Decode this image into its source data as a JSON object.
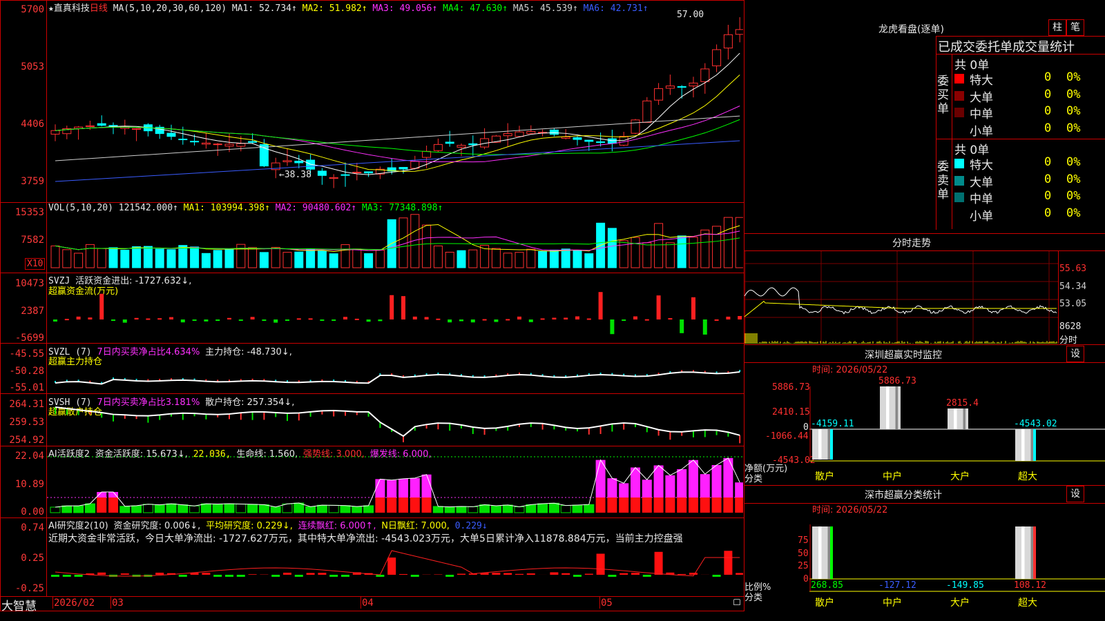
{
  "stock": {
    "star": "★",
    "name": "直真科技",
    "period": "日线",
    "ma_header": "MA(5,10,20,30,60,120)",
    "ma1": "MA1: 52.734↑",
    "ma2": "MA2: 51.982↑",
    "ma3": "MA3: 49.056↑",
    "ma4": "MA4: 47.630↑",
    "ma5": "MA5: 45.539↑",
    "ma6": "MA6: 42.731↑",
    "high_marker": "57.00",
    "low_marker": "←38.38"
  },
  "price_axis": [
    "5700",
    "5053",
    "4406",
    "3759"
  ],
  "vol": {
    "header": "VOL(5,10,20)",
    "value": "121542.000↑",
    "ma1": "MA1: 103994.398↑",
    "ma2": "MA2: 90480.602↑",
    "ma3": "MA3: 77348.898↑",
    "axis": [
      "15353",
      "7582"
    ],
    "multiplier": "X10"
  },
  "svzj": {
    "header": "SVZJ",
    "line1": "活跃资金进出: -1727.632↓,",
    "line2": "超赢资金流(万元)",
    "axis": [
      "10473",
      "2387",
      "-5699"
    ]
  },
  "svzl": {
    "header": "SVZL (7)",
    "pct": "7日内买卖净占比4.634%",
    "main": "主力持仓: -48.730↓,",
    "line2": "超赢主力持仓",
    "axis": [
      "-45.55",
      "-50.28",
      "-55.01"
    ]
  },
  "svsh": {
    "header": "SVSH (7)",
    "pct": "7日内买卖净占比3.181%",
    "retail": "散户持仓: 257.354↓,",
    "line2": "超赢散户持仓",
    "axis": [
      "264.31",
      "259.53",
      "254.92"
    ]
  },
  "ai2": {
    "header": "AI活跃度2",
    "act": "资金活跃度: 15.673↓,",
    "v2": "22.036,",
    "life": "生命线: 1.560,",
    "strong": "强势线: 3.000,",
    "burst": "爆发线: 6.000,",
    "axis": [
      "22.04",
      "10.89",
      "0.00"
    ]
  },
  "airesearch": {
    "header": "AI研究度2(10)",
    "research": "资金研究度: 0.006↓,",
    "avg": "平均研究度: 0.229↓,",
    "cont": "连续飘红: 6.000↑,",
    "nday": "N日飘红: 7.000,",
    "last": "0.229↓",
    "summary": "近期大资金非常活跃，今日大单净流出: -1727.627万元，其中特大单净流出: -4543.023万元，大单5日累计净入11878.884万元，当前主力控盘强",
    "axis": [
      "0.74",
      "0.25",
      "-0.25"
    ]
  },
  "bottom": {
    "brand": "大智慧",
    "dates": [
      "2026/02",
      "03",
      "04",
      "05"
    ]
  },
  "longhu": {
    "title": "龙虎看盘(逐单)",
    "btn1": "柱",
    "btn2": "笔",
    "header": "已成交委托单成交量统计",
    "buy_label": "委买单",
    "sell_label": "委卖单",
    "buy_total": "共 0单",
    "sell_total": "共 0单",
    "buy_rows": [
      {
        "label": "特大",
        "count": "0",
        "pct": "0%",
        "color": "#ff0000"
      },
      {
        "label": "大单",
        "count": "0",
        "pct": "0%",
        "color": "#8b0000"
      },
      {
        "label": "中单",
        "count": "0",
        "pct": "0%",
        "color": "#6a0000"
      },
      {
        "label": "小单",
        "count": "0",
        "pct": "0%",
        "color": "#000000"
      }
    ],
    "sell_rows": [
      {
        "label": "特大",
        "count": "0",
        "pct": "0%",
        "color": "#00ffff"
      },
      {
        "label": "大单",
        "count": "0",
        "pct": "0%",
        "color": "#008b8b"
      },
      {
        "label": "中单",
        "count": "0",
        "pct": "0%",
        "color": "#007070"
      },
      {
        "label": "小单",
        "count": "0",
        "pct": "0%",
        "color": "#000000"
      }
    ]
  },
  "intraday": {
    "title": "分时走势",
    "axis": [
      "55.63",
      "54.34",
      "53.05",
      "8628"
    ],
    "unit": "分时"
  },
  "sz_monitor": {
    "title": "深圳超赢实时监控",
    "btn": "设",
    "time": "时间: 2026/05/22",
    "axis": [
      "5886.73",
      "2410.15",
      "0",
      "-1066.44",
      "-4543.02"
    ],
    "ylabel": "净额(万元)",
    "xlabel": "分类",
    "categories": [
      "散户",
      "中户",
      "大户",
      "超大"
    ],
    "values": [
      "-4159.11",
      "5886.73",
      "2815.4",
      "-4543.02"
    ]
  },
  "sz_stats": {
    "title": "深市超赢分类统计",
    "btn": "设",
    "time": "时间: 2026/05/22",
    "axis": [
      "75",
      "50",
      "25",
      "0"
    ],
    "ylabel": "比例%",
    "xlabel": "分类",
    "categories": [
      "散户",
      "中户",
      "大户",
      "超大"
    ],
    "values": [
      "268.85",
      "-127.12",
      "-149.85",
      "108.12"
    ]
  }
}
